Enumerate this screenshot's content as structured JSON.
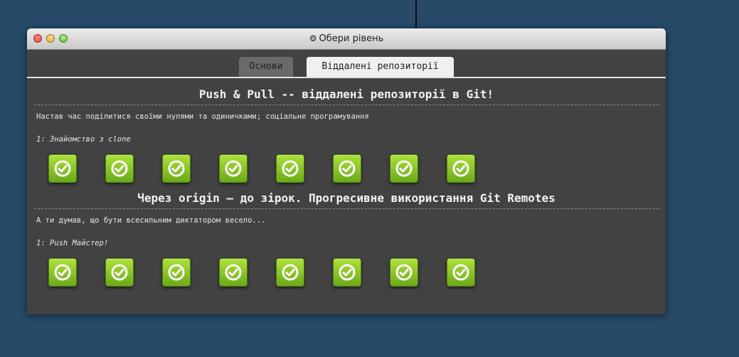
{
  "window": {
    "title_icon": "gear-icon",
    "title": "Обери рівень"
  },
  "tabs": [
    {
      "label": "Основи",
      "active": false
    },
    {
      "label": "Віддалені репозиторії",
      "active": true
    }
  ],
  "sections": [
    {
      "title": "Push & Pull -- віддалені репозиторії в Git!",
      "description": "Настав час поділитися своїми нулями та одиничками; соціальне програмування",
      "subtitle": "1: Знайомство з clone",
      "levels": [
        {
          "status": "completed",
          "icon": "checkmark-icon"
        },
        {
          "status": "completed",
          "icon": "checkmark-icon"
        },
        {
          "status": "completed",
          "icon": "checkmark-icon"
        },
        {
          "status": "completed",
          "icon": "checkmark-icon"
        },
        {
          "status": "completed",
          "icon": "checkmark-icon"
        },
        {
          "status": "completed",
          "icon": "checkmark-icon"
        },
        {
          "status": "completed",
          "icon": "checkmark-icon"
        },
        {
          "status": "completed",
          "icon": "checkmark-icon"
        }
      ]
    },
    {
      "title": "Через origin – до зірок. Прогресивне використання Git Remotes",
      "description": "А ти думав, що бути всесильним диктатором весело...",
      "subtitle": "1: Push Майстер!",
      "levels": [
        {
          "status": "completed",
          "icon": "checkmark-icon"
        },
        {
          "status": "completed",
          "icon": "checkmark-icon"
        },
        {
          "status": "completed",
          "icon": "checkmark-icon"
        },
        {
          "status": "completed",
          "icon": "checkmark-icon"
        },
        {
          "status": "completed",
          "icon": "checkmark-icon"
        },
        {
          "status": "completed",
          "icon": "checkmark-icon"
        },
        {
          "status": "completed",
          "icon": "checkmark-icon"
        },
        {
          "status": "completed",
          "icon": "checkmark-icon"
        }
      ]
    }
  ],
  "colors": {
    "background": "#264a67",
    "window": "#424242",
    "level_completed": "#8cc63f"
  }
}
